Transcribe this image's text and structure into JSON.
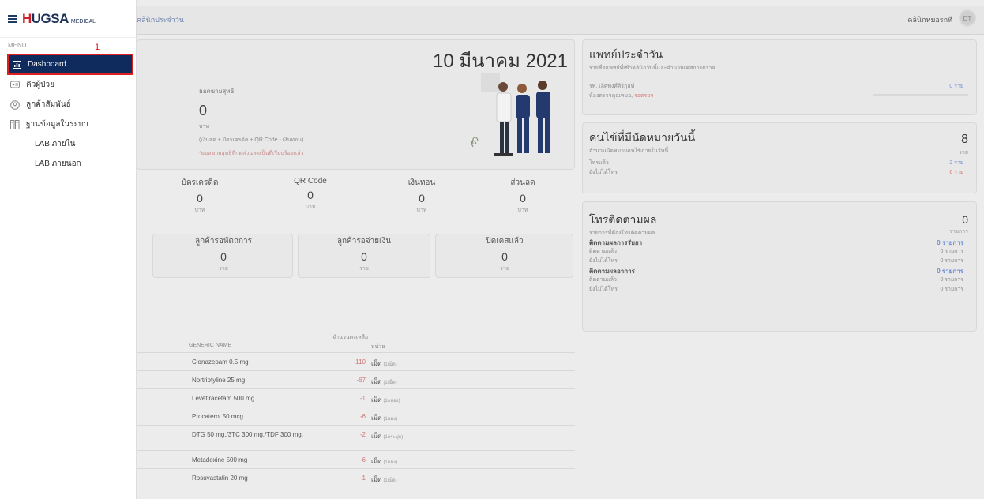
{
  "logo": {
    "brand_part1": "H",
    "brand_part2": "UGSA",
    "sub": "MEDICAL"
  },
  "menu": {
    "header": "MENU",
    "annotation": "1",
    "items": [
      {
        "label": "Dashboard"
      },
      {
        "label": "คิวผู้ป่วย"
      },
      {
        "label": "ลูกค้าสัมพันธ์"
      },
      {
        "label": "ฐานข้อมูลในระบบ"
      },
      {
        "label": "LAB ภายใน"
      },
      {
        "label": "LAB ภายนอก"
      }
    ]
  },
  "topbar": {
    "tab": "คลินิกประจำวัน",
    "user": "คลินิกหมอรถที",
    "avatar": "DT"
  },
  "summary": {
    "date": "10 มีนาคม 2021",
    "net_label": "ยอดขายสุทธิ",
    "net_value": "0",
    "net_unit": "บาท",
    "net_formula": "(เงินสด + บัตรเครดิต + QR Code - เงินทอน)",
    "net_note": "*ยอดขายสุทธิที่กดส่วนลดเป็นที่เรียบร้อยแล้ว"
  },
  "payments": [
    {
      "label": "บัตรเครดิต",
      "value": "0",
      "unit": "บาท"
    },
    {
      "label": "QR Code",
      "value": "0",
      "unit": "บาท"
    },
    {
      "label": "เงินทอน",
      "value": "0",
      "unit": "บาท"
    },
    {
      "label": "ส่วนลด",
      "value": "0",
      "unit": "บาท"
    }
  ],
  "customers": [
    {
      "label": "ลูกค้ารอหัตถการ",
      "value": "0",
      "unit": "ราย"
    },
    {
      "label": "ลูกค้ารอจ่ายเงิน",
      "value": "0",
      "unit": "ราย"
    },
    {
      "label": "ปิดเคสแล้ว",
      "value": "0",
      "unit": "ราย"
    }
  ],
  "stock_table": {
    "col_name": "GENERIC NAME",
    "col_qty": "จำนวนคงเหลือ",
    "col_unit": "หน่วย",
    "rows": [
      {
        "name": "Clonazepam 0.5 mg",
        "qty": "-110",
        "unit": "เม็ด",
        "unit_note": "(1เม็ด)"
      },
      {
        "name": "Nortriptyline 25 mg",
        "qty": "-67",
        "unit": "เม็ด",
        "unit_note": "(1เม็ด)"
      },
      {
        "name": "Levetiracetam 500 mg",
        "qty": "-1",
        "unit": "เม็ด",
        "unit_note": "(1กล่อง)"
      },
      {
        "name": "Procaterol 50 mcg",
        "qty": "-6",
        "unit": "เม็ด",
        "unit_note": "(1แผง)"
      },
      {
        "name": "DTG 50 mg./3TC 300 mg./TDF 300 mg.",
        "qty": "-2",
        "unit": "เม็ด",
        "unit_note": "(1กระปุก)"
      },
      {
        "name": "Metadoxine 500 mg",
        "qty": "-6",
        "unit": "เม็ด",
        "unit_note": "(1แผง)"
      },
      {
        "name": "Rosuvastatin 20 mg",
        "qty": "-1",
        "unit": "เม็ด",
        "unit_note": "(1เม็ด)"
      }
    ]
  },
  "doctor_panel": {
    "title": "แพทย์ประจำวัน",
    "sub": "รายชื่อแพทย์ที่เข้าคลินิกวันนี้และจำนวนเคสการตรวจ",
    "doctor": "รพ. เลิศพงศ์ศิริกุลท์",
    "room": "ห้องตรวจคุณหมอ,",
    "room_status": "รอตรวจ",
    "count": "0 ราย"
  },
  "appointment_panel": {
    "title": "คนไข้ที่มีนัดหมายวันนี้",
    "sub": "จำนวนนัดหมายคนไข้ภายในวันนี้",
    "total": "8",
    "total_unit": "ราย",
    "called_label": "โทรแล้ว",
    "called_value": "2 ราย",
    "not_called_label": "ยังไม่ได้โทร",
    "not_called_value": "6 ราย"
  },
  "followup_panel": {
    "title": "โทรติดตามผล",
    "sub": "รายการที่ต้องโทรติดตามผล",
    "total": "0",
    "total_unit": "รายการ",
    "med_label": "ติดตามผลการรับยา",
    "med_value": "0 รายการ",
    "med_done_label": "ติดตามแล้ว",
    "med_done_value": "0 รายการ",
    "med_pending_label": "ยังไม่ได้โทร",
    "med_pending_value": "0 รายการ",
    "sym_label": "ติดตามผลอาการ",
    "sym_value": "0 รายการ",
    "sym_done_label": "ติดตามแล้ว",
    "sym_done_value": "0 รายการ",
    "sym_pending_label": "ยังไม่ได้โทร",
    "sym_pending_value": "0 รายการ"
  }
}
